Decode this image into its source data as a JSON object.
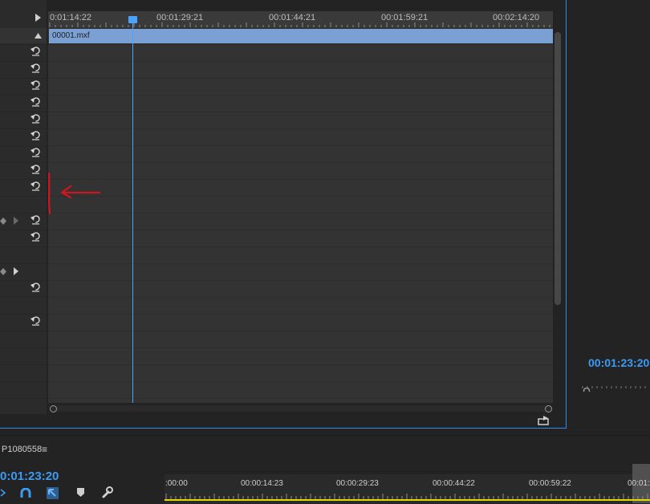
{
  "effect_controls": {
    "ruler_ticks": [
      "0:01:14:22",
      "00:01:29:21",
      "00:01:44:21",
      "00:01:59:21",
      "00:02:14:20"
    ],
    "clip_name": "00001.mxf"
  },
  "program_monitor": {
    "timecode": "00:01:23:20"
  },
  "sequence": {
    "name": "P1080558",
    "menu_glyph": "≡",
    "timecode": "0:01:23:20",
    "ruler_ticks": [
      ":00:00",
      "00:00:14:23",
      "00:00:29:23",
      "00:00:44:22",
      "00:00:59:22",
      "00:01:"
    ]
  },
  "colors": {
    "accent": "#3b9bf5",
    "clip": "#7aa0d4",
    "annotation": "#d0161c",
    "work_area": "#e5d800"
  },
  "icons": [
    "play-triangle-icon",
    "collapse-triangle-icon",
    "reset-icon",
    "keyframe-diamond-icon",
    "keyframe-next-icon",
    "export-frame-icon",
    "ripple-edit-icon",
    "snap-magnet-icon",
    "linked-selection-icon",
    "add-marker-icon",
    "wrench-icon",
    "red-arrow-annotation"
  ]
}
